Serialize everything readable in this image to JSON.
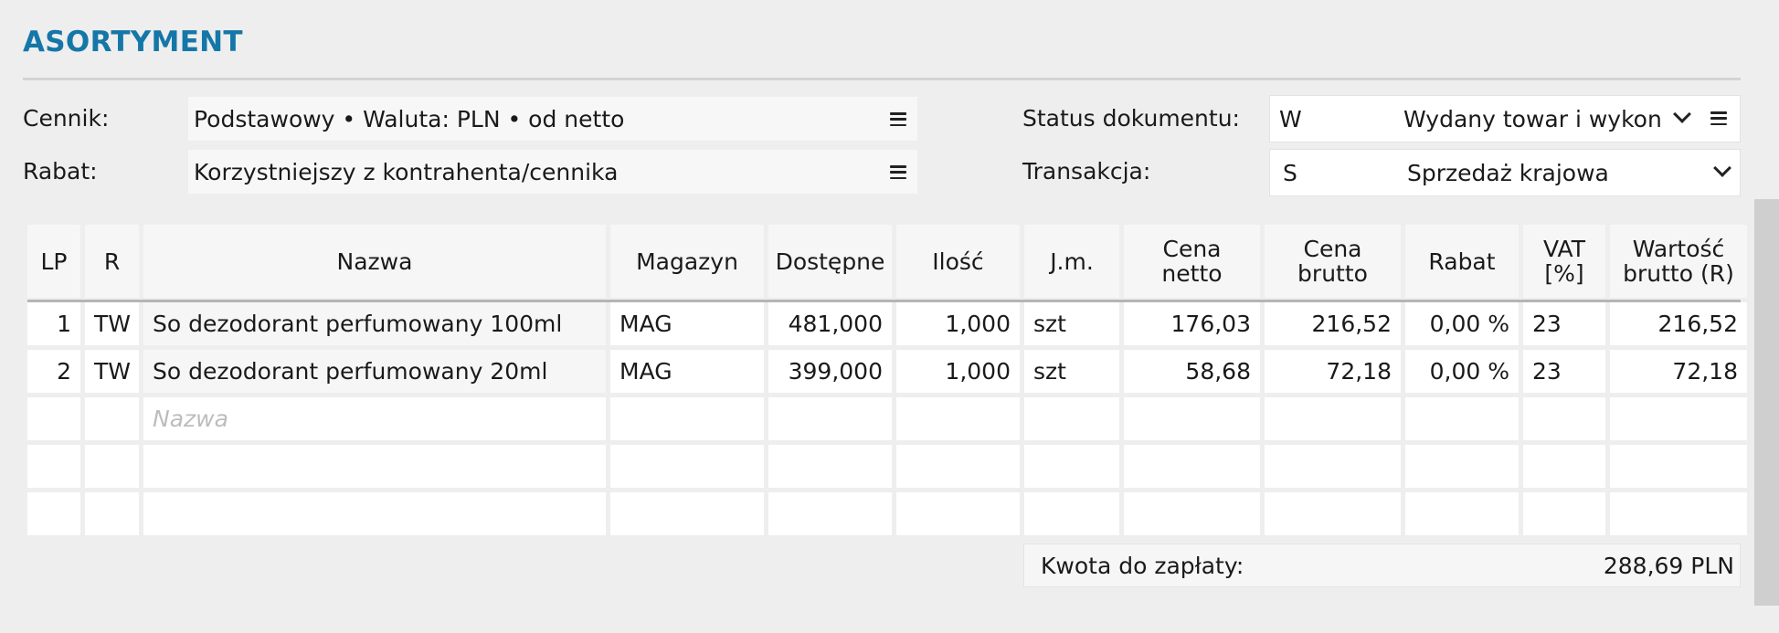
{
  "section": {
    "title": "ASORTYMENT"
  },
  "form": {
    "cennik": {
      "label": "Cennik:",
      "value": "Podstawowy • Waluta: PLN • od netto"
    },
    "rabat": {
      "label": "Rabat:",
      "value": "Korzystniejszy z kontrahenta/cennika"
    },
    "status": {
      "label": "Status dokumentu:",
      "code": "W",
      "value": "Wydany towar i wykona"
    },
    "transakcja": {
      "label": "Transakcja:",
      "code": "S",
      "value": "Sprzedaż krajowa"
    }
  },
  "table": {
    "headers": {
      "lp": "LP",
      "r": "R",
      "nazwa": "Nazwa",
      "magazyn": "Magazyn",
      "dostepne": "Dostępne",
      "ilosc": "Ilość",
      "jm": "J.m.",
      "cena_netto_1": "Cena",
      "cena_netto_2": "netto",
      "cena_brutto_1": "Cena",
      "cena_brutto_2": "brutto",
      "rabat": "Rabat",
      "vat_1": "VAT",
      "vat_2": "[%]",
      "wartosc_1": "Wartość",
      "wartosc_2": "brutto (R)"
    },
    "rows": [
      {
        "lp": "1",
        "r": "TW",
        "nazwa": "So dezodorant perfumowany 100ml",
        "magazyn": "MAG",
        "dostepne": "481,000",
        "ilosc": "1,000",
        "jm": "szt",
        "cena_netto": "176,03",
        "cena_brutto": "216,52",
        "rabat": "0,00 %",
        "vat": "23",
        "wartosc": "216,52"
      },
      {
        "lp": "2",
        "r": "TW",
        "nazwa": "So dezodorant perfumowany 20ml",
        "magazyn": "MAG",
        "dostepne": "399,000",
        "ilosc": "1,000",
        "jm": "szt",
        "cena_netto": "58,68",
        "cena_brutto": "72,18",
        "rabat": "0,00 %",
        "vat": "23",
        "wartosc": "72,18"
      }
    ],
    "new_row_placeholder": "Nazwa"
  },
  "total": {
    "label": "Kwota do zapłaty:",
    "value": "288,69 PLN"
  }
}
